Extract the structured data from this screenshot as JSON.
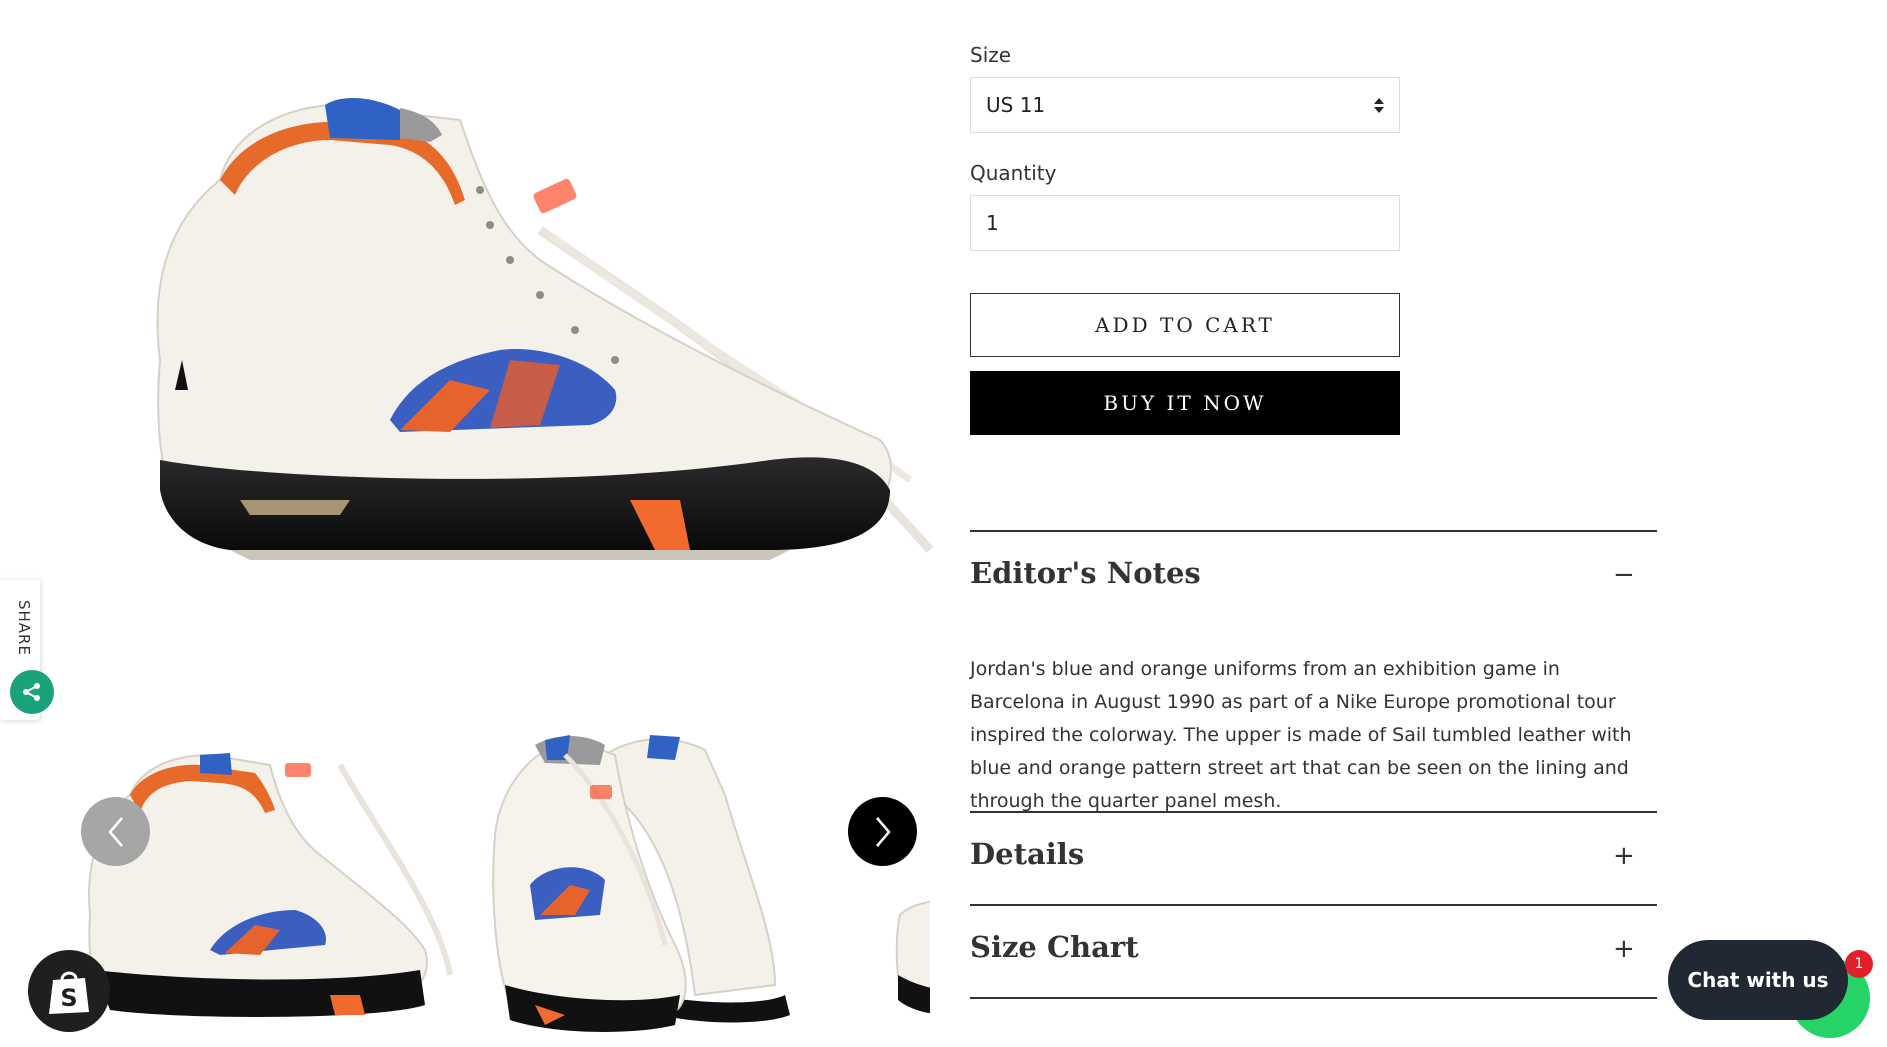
{
  "product": {
    "images": {
      "main_alt": "Air Jordan 5 sneaker, side view",
      "thumb_alts": [
        "Air Jordan 5 sneaker, side view",
        "Air Jordan 5 pair, front three-quarter view",
        "Air Jordan 5 partial view"
      ]
    }
  },
  "share": {
    "label": "SHARE",
    "icon": "share-icon",
    "color": "#1aa37a"
  },
  "form": {
    "size_label": "Size",
    "size_value": "US 11",
    "quantity_label": "Quantity",
    "quantity_value": "1",
    "add_to_cart": "ADD TO CART",
    "buy_now": "BUY IT NOW"
  },
  "accordions": [
    {
      "title": "Editor's Notes",
      "icon": "−",
      "expanded": true,
      "body": "Jordan's blue and orange uniforms from an exhibition game in Barcelona in August 1990 as part of a Nike Europe promotional tour inspired the colorway. The upper is made of Sail tumbled leather with blue and orange pattern street art that can be seen on the lining and through the quarter panel mesh."
    },
    {
      "title": "Details",
      "icon": "+",
      "expanded": false
    },
    {
      "title": "Size Chart",
      "icon": "+",
      "expanded": false
    }
  ],
  "chat": {
    "label": "Chat with us",
    "badge": "1",
    "icon": "whatsapp-icon",
    "color": "#1f2833",
    "accent": "#25d366"
  },
  "shopify": {
    "icon": "shopify-bag-icon"
  }
}
